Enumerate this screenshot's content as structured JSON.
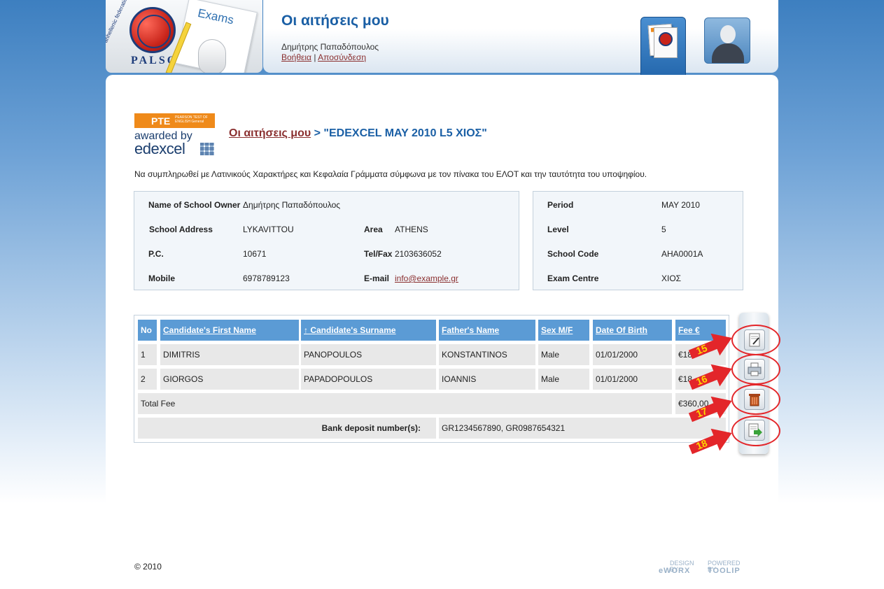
{
  "header": {
    "logo_text": "PALSO",
    "logo_ring_text": "Panhellenic federation of language schools",
    "exams_label": "Exams",
    "page_title": "Οι αιτήσεις μου",
    "user_name": "Δημήτρης Παπαδόπουλος",
    "help_link": "Βοήθεια",
    "separator": "|",
    "logout_link": "Αποσύνδεση"
  },
  "badge": {
    "pte": "PTE",
    "small": "PEARSON TEST OF ENGLISH General",
    "awarded": "awarded by",
    "edexcel": "edexcel"
  },
  "breadcrumb": {
    "link": "Οι αιτήσεις μου",
    "separator": ">",
    "current": "\"EDEXCEL MAY 2010 L5 ΧΙΟΣ\""
  },
  "instructions": "Να συμπληρωθεί με Λατινικούς Χαρακτήρες και Κεφαλαία Γράμματα σύμφωνα με τον πίνακα του ΕΛΟΤ και την ταυτότητα του υποψηφίου.",
  "school_info": {
    "owner_label": "Name of School Owner",
    "owner_value": "Δημήτρης Παπαδόπουλος",
    "address_label": "School Address",
    "address_value": "LYKAVITTOU",
    "area_label": "Area",
    "area_value": "ATHENS",
    "pc_label": "P.C.",
    "pc_value": "10671",
    "telfax_label": "Tel/Fax",
    "telfax_value": "2103636052",
    "mobile_label": "Mobile",
    "mobile_value": "6978789123",
    "email_label": "E-mail",
    "email_value": "info@example.gr"
  },
  "exam_info": {
    "period_label": "Period",
    "period_value": "MAY 2010",
    "level_label": "Level",
    "level_value": "5",
    "code_label": "School Code",
    "code_value": "AHA0001A",
    "centre_label": "Exam Centre",
    "centre_value": "ΧΙΟΣ"
  },
  "table": {
    "headers": {
      "no": "No",
      "first_name": "Candidate's First Name",
      "surname": "↑ Candidate's Surname",
      "father": "Father's Name",
      "sex": "Sex M/F",
      "dob": "Date Of Birth",
      "fee": "Fee €"
    },
    "rows": [
      {
        "no": "1",
        "first_name": "DIMITRIS",
        "surname": "PANOPOULOS",
        "father": "KONSTANTINOS",
        "sex": "Male",
        "dob": "01/01/2000",
        "fee": "€18"
      },
      {
        "no": "2",
        "first_name": "GIORGOS",
        "surname": "PAPADOPOULOS",
        "father": "IOANNIS",
        "sex": "Male",
        "dob": "01/01/2000",
        "fee": "€18"
      }
    ],
    "total_label": "Total Fee",
    "total_value": "€360,00",
    "bank_label": "Bank deposit number(s):",
    "bank_value": "GR1234567890, GR0987654321"
  },
  "toolbar": {
    "buttons": [
      {
        "icon": "edit-icon",
        "marker": "15"
      },
      {
        "icon": "print-icon",
        "marker": "16"
      },
      {
        "icon": "delete-icon",
        "marker": "17"
      },
      {
        "icon": "submit-icon",
        "marker": "18"
      }
    ]
  },
  "footer": {
    "copyright": "© 2010",
    "design_by": "DESIGN BY",
    "design_brand": "eWORX",
    "powered_by": "POWERED BY",
    "powered_brand": "TOOLIP"
  },
  "colors": {
    "accent": "#1a5fa5",
    "header_cell": "#5b9bd5",
    "link": "#8a2f2f",
    "marker": "#e3262a"
  }
}
